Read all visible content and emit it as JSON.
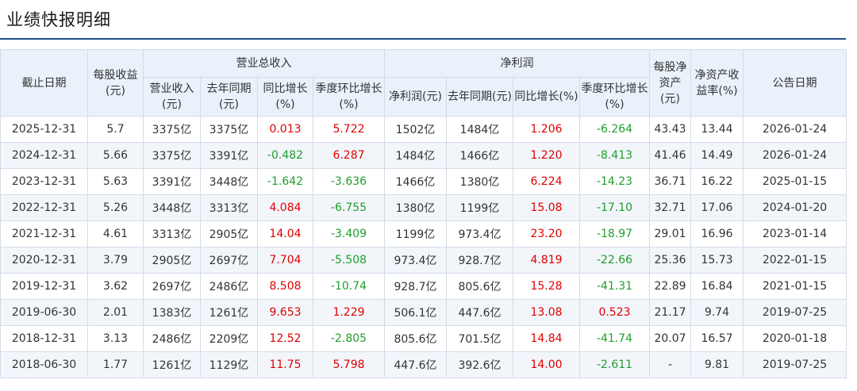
{
  "title": "业绩快报明细",
  "colors": {
    "up": "#e00000",
    "down": "#1f9e2c",
    "header_bg": "#e9f1fa",
    "accent": "#1d4e89"
  },
  "headers": {
    "date": "截止日期",
    "eps": "每股收益(元)",
    "revenue_group": "营业总收入",
    "rev": "营业收入(元)",
    "rev_prev": "去年同期(元)",
    "rev_yoy": "同比增长(%)",
    "rev_qoq": "季度环比增长(%)",
    "profit_group": "净利润",
    "np": "净利润(元)",
    "np_prev": "去年同期(元)",
    "np_yoy": "同比增长(%)",
    "np_qoq": "季度环比增长(%)",
    "bvps": "每股净资产(元)",
    "roe": "净资产收益率(%)",
    "announce": "公告日期"
  },
  "rows": [
    {
      "date": "2025-12-31",
      "eps": "5.7",
      "rev": "3375亿",
      "rev_prev": "3375亿",
      "rev_yoy": "0.013",
      "rev_yoy_dir": "up",
      "rev_qoq": "5.722",
      "rev_qoq_dir": "up",
      "np": "1502亿",
      "np_prev": "1484亿",
      "np_yoy": "1.206",
      "np_yoy_dir": "up",
      "np_qoq": "-6.264",
      "np_qoq_dir": "down",
      "bvps": "43.43",
      "roe": "13.44",
      "announce": "2026-01-24"
    },
    {
      "date": "2024-12-31",
      "eps": "5.66",
      "rev": "3375亿",
      "rev_prev": "3391亿",
      "rev_yoy": "-0.482",
      "rev_yoy_dir": "down",
      "rev_qoq": "6.287",
      "rev_qoq_dir": "up",
      "np": "1484亿",
      "np_prev": "1466亿",
      "np_yoy": "1.220",
      "np_yoy_dir": "up",
      "np_qoq": "-8.413",
      "np_qoq_dir": "down",
      "bvps": "41.46",
      "roe": "14.49",
      "announce": "2026-01-24"
    },
    {
      "date": "2023-12-31",
      "eps": "5.63",
      "rev": "3391亿",
      "rev_prev": "3448亿",
      "rev_yoy": "-1.642",
      "rev_yoy_dir": "down",
      "rev_qoq": "-3.636",
      "rev_qoq_dir": "down",
      "np": "1466亿",
      "np_prev": "1380亿",
      "np_yoy": "6.224",
      "np_yoy_dir": "up",
      "np_qoq": "-14.23",
      "np_qoq_dir": "down",
      "bvps": "36.71",
      "roe": "16.22",
      "announce": "2025-01-15"
    },
    {
      "date": "2022-12-31",
      "eps": "5.26",
      "rev": "3448亿",
      "rev_prev": "3313亿",
      "rev_yoy": "4.084",
      "rev_yoy_dir": "up",
      "rev_qoq": "-6.755",
      "rev_qoq_dir": "down",
      "np": "1380亿",
      "np_prev": "1199亿",
      "np_yoy": "15.08",
      "np_yoy_dir": "up",
      "np_qoq": "-17.10",
      "np_qoq_dir": "down",
      "bvps": "32.71",
      "roe": "17.06",
      "announce": "2024-01-20"
    },
    {
      "date": "2021-12-31",
      "eps": "4.61",
      "rev": "3313亿",
      "rev_prev": "2905亿",
      "rev_yoy": "14.04",
      "rev_yoy_dir": "up",
      "rev_qoq": "-3.409",
      "rev_qoq_dir": "down",
      "np": "1199亿",
      "np_prev": "973.4亿",
      "np_yoy": "23.20",
      "np_yoy_dir": "up",
      "np_qoq": "-18.97",
      "np_qoq_dir": "down",
      "bvps": "29.01",
      "roe": "16.96",
      "announce": "2023-01-14"
    },
    {
      "date": "2020-12-31",
      "eps": "3.79",
      "rev": "2905亿",
      "rev_prev": "2697亿",
      "rev_yoy": "7.704",
      "rev_yoy_dir": "up",
      "rev_qoq": "-5.508",
      "rev_qoq_dir": "down",
      "np": "973.4亿",
      "np_prev": "928.7亿",
      "np_yoy": "4.819",
      "np_yoy_dir": "up",
      "np_qoq": "-22.66",
      "np_qoq_dir": "down",
      "bvps": "25.36",
      "roe": "15.73",
      "announce": "2022-01-15"
    },
    {
      "date": "2019-12-31",
      "eps": "3.62",
      "rev": "2697亿",
      "rev_prev": "2486亿",
      "rev_yoy": "8.508",
      "rev_yoy_dir": "up",
      "rev_qoq": "-10.74",
      "rev_qoq_dir": "down",
      "np": "928.7亿",
      "np_prev": "805.6亿",
      "np_yoy": "15.28",
      "np_yoy_dir": "up",
      "np_qoq": "-41.31",
      "np_qoq_dir": "down",
      "bvps": "22.89",
      "roe": "16.84",
      "announce": "2021-01-15"
    },
    {
      "date": "2019-06-30",
      "eps": "2.01",
      "rev": "1383亿",
      "rev_prev": "1261亿",
      "rev_yoy": "9.653",
      "rev_yoy_dir": "up",
      "rev_qoq": "1.229",
      "rev_qoq_dir": "up",
      "np": "506.1亿",
      "np_prev": "447.6亿",
      "np_yoy": "13.08",
      "np_yoy_dir": "up",
      "np_qoq": "0.523",
      "np_qoq_dir": "up",
      "bvps": "21.17",
      "roe": "9.74",
      "announce": "2019-07-25"
    },
    {
      "date": "2018-12-31",
      "eps": "3.13",
      "rev": "2486亿",
      "rev_prev": "2209亿",
      "rev_yoy": "12.52",
      "rev_yoy_dir": "up",
      "rev_qoq": "-2.805",
      "rev_qoq_dir": "down",
      "np": "805.6亿",
      "np_prev": "701.5亿",
      "np_yoy": "14.84",
      "np_yoy_dir": "up",
      "np_qoq": "-41.74",
      "np_qoq_dir": "down",
      "bvps": "20.07",
      "roe": "16.57",
      "announce": "2020-01-18"
    },
    {
      "date": "2018-06-30",
      "eps": "1.77",
      "rev": "1261亿",
      "rev_prev": "1129亿",
      "rev_yoy": "11.75",
      "rev_yoy_dir": "up",
      "rev_qoq": "5.798",
      "rev_qoq_dir": "up",
      "np": "447.6亿",
      "np_prev": "392.6亿",
      "np_yoy": "14.00",
      "np_yoy_dir": "up",
      "np_qoq": "-2.611",
      "np_qoq_dir": "down",
      "bvps": "-",
      "roe": "9.81",
      "announce": "2019-07-25"
    }
  ]
}
